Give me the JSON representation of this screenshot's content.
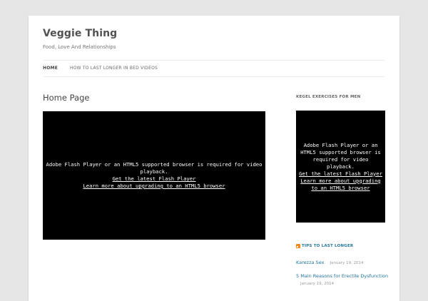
{
  "site": {
    "title": "Veggie Thing",
    "description": "Food, Love And Relationships"
  },
  "nav": {
    "items": [
      {
        "label": "HOME"
      },
      {
        "label": "HOW TO LAST LONGER IN BED VIDEOS"
      }
    ]
  },
  "main": {
    "heading": "Home Page",
    "player": {
      "message": "Adobe Flash Player or an HTML5 supported browser is required for video playback.",
      "link1": "Get the latest Flash Player",
      "link2": "Learn more about upgrading to an HTML5 browser"
    }
  },
  "sidebar": {
    "widget1_title": "KEGEL EXERCISES FOR MEN",
    "player": {
      "message": "Adobe Flash Player or an HTML5 supported browser is required for video playback.",
      "link1": "Get the latest Flash Player",
      "link2": "Learn more about upgrading to an HTML5 browser"
    },
    "widget2_title": "TIPS TO LAST LONGER",
    "posts": [
      {
        "title": "Karezza Sex",
        "date": "January 19, 2014"
      },
      {
        "title": "5 Main Reasons for Erectile Dysfunction",
        "date": "January 19, 2014"
      }
    ]
  },
  "colors": {
    "background": "#e6e6e6",
    "link": "#21759b",
    "rss": "#f28a18"
  }
}
